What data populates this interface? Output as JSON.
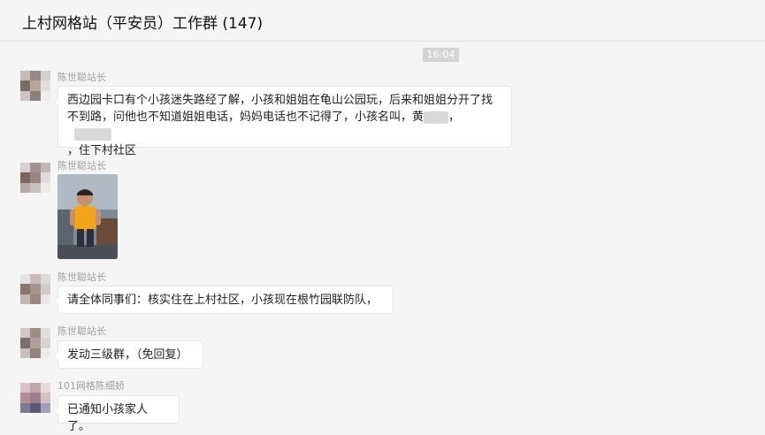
{
  "header": {
    "title": "上村网格站（平安员）工作群 (147)"
  },
  "time_divider": "16:04",
  "messages": [
    {
      "sender": "陈世聪站长",
      "lines": [
        "西边园卡口有个小孩迷失路经了解，小孩和姐姐在龟山公园玩，后来和姐姐分开了找",
        "不到路，问他也不知道姐姐电话，妈妈电话也不记得了，小孩名叫，黄",
        "，住下村社区"
      ],
      "name_sep": "，"
    },
    {
      "sender": "陈世聪站长",
      "image": "child-photo"
    },
    {
      "sender": "陈世聪站长",
      "text": "请全体同事们：核实住在上村社区，小孩现在根竹园联防队，"
    },
    {
      "sender": "陈世聪站长",
      "text": "发动三级群，（免回复）"
    },
    {
      "sender": "101网格陈细娇",
      "text": "已通知小孩家人了。"
    }
  ]
}
